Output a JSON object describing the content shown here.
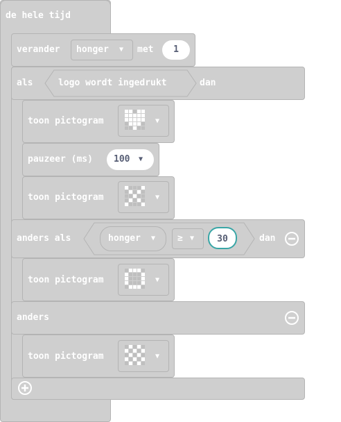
{
  "event": {
    "label": "de hele tijd"
  },
  "change": {
    "verb": "verander",
    "variable": "honger",
    "with_label": "met",
    "value": "1"
  },
  "if": {
    "if_label": "als",
    "condition": "logo wordt ingedrukt",
    "then_label": "dan"
  },
  "show1": {
    "label": "toon pictogram",
    "icon": "heart-icon"
  },
  "pause": {
    "label": "pauzeer (ms)",
    "value": "100"
  },
  "show2": {
    "label": "toon pictogram",
    "icon": "led-pattern-icon"
  },
  "elseif": {
    "label": "anders als",
    "variable": "honger",
    "operator": "≥",
    "value": "30",
    "then_label": "dan"
  },
  "show3": {
    "label": "toon pictogram",
    "icon": "led-pattern-icon"
  },
  "else": {
    "label": "anders"
  },
  "show4": {
    "label": "toon pictogram",
    "icon": "led-pattern-icon"
  },
  "colors": {
    "block": "#cfcfcf",
    "border": "#b4b4b4",
    "text": "#ffffff",
    "value_text": "#575e75"
  }
}
